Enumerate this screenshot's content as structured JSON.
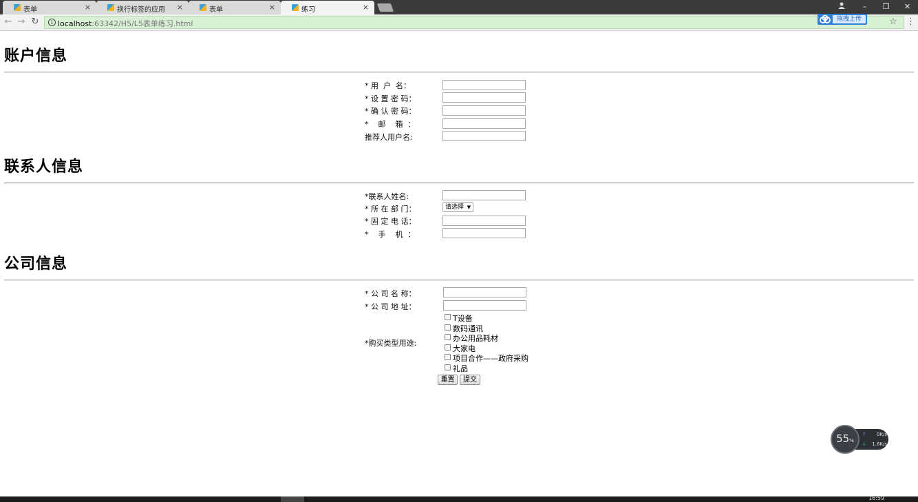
{
  "browser": {
    "tabs": [
      {
        "title": "表单",
        "active": false
      },
      {
        "title": "换行标签的应用",
        "active": false
      },
      {
        "title": "表单",
        "active": false
      },
      {
        "title": "练习",
        "active": true
      }
    ],
    "tab_close_glyph": "×",
    "url_host": "localhost",
    "url_path": ":63342/H5/L5表单练习.html",
    "upload_label": "拖拽上传",
    "window_controls": [
      "–",
      "❐",
      "✕"
    ]
  },
  "account": {
    "title": "账户信息",
    "fields": [
      {
        "label": "* 用  户  名：",
        "value": ""
      },
      {
        "label": "* 设 置 密 码：",
        "value": ""
      },
      {
        "label": "* 确 认 密 码：",
        "value": ""
      },
      {
        "label": "*    邮    箱  ：",
        "value": ""
      },
      {
        "label": "推荐人用户名:",
        "value": ""
      }
    ]
  },
  "contact": {
    "title": "联系人信息",
    "name_label": "*联系人姓名:",
    "dept_label": "* 所 在 部 门：",
    "dept_selected": "请选择",
    "phone_label": "* 固 定 电 话：",
    "mobile_label": "*    手    机  ："
  },
  "company": {
    "title": "公司信息",
    "name_label": "* 公 司 名 称：",
    "address_label": "* 公 司 地 址：",
    "purpose_label": "*购买类型用途:",
    "purposes": [
      "T设备",
      "数码通讯",
      "办公用品耗材",
      "大家电",
      "项目合作——政府采购",
      "礼品"
    ],
    "reset_label": "重置",
    "submit_label": "提交"
  },
  "speed_widget": {
    "percent": "55",
    "percent_unit": "%",
    "upload_speed": "0K/s",
    "download_speed": "1.6K/s"
  },
  "taskbar": {
    "clock": "16:59"
  }
}
